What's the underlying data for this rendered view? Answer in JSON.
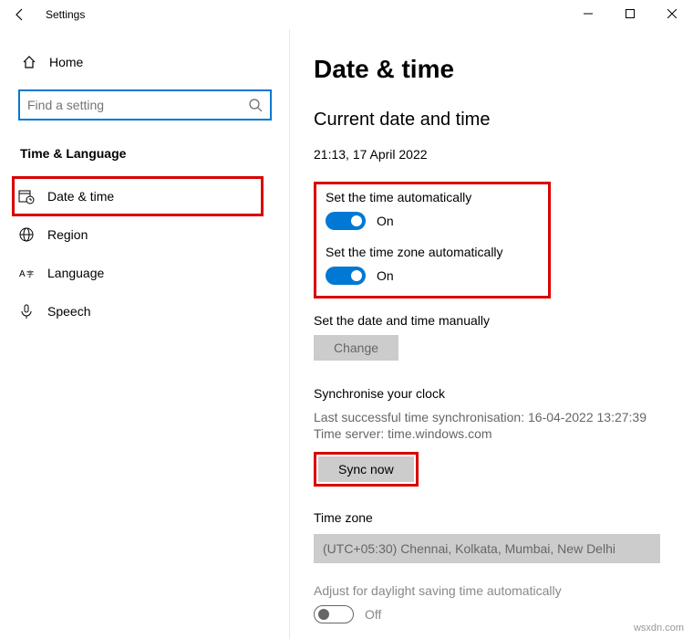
{
  "window": {
    "title": "Settings"
  },
  "sidebar": {
    "home_label": "Home",
    "search_placeholder": "Find a setting",
    "category": "Time & Language",
    "items": [
      {
        "label": "Date & time",
        "selected": true
      },
      {
        "label": "Region",
        "selected": false
      },
      {
        "label": "Language",
        "selected": false
      },
      {
        "label": "Speech",
        "selected": false
      }
    ]
  },
  "main": {
    "page_title": "Date & time",
    "section_title": "Current date and time",
    "current_datetime": "21:13, 17 April 2022",
    "auto_time_label": "Set the time automatically",
    "auto_time_state": "On",
    "auto_tz_label": "Set the time zone automatically",
    "auto_tz_state": "On",
    "manual_label": "Set the date and time manually",
    "change_btn": "Change",
    "sync_title": "Synchronise your clock",
    "sync_last": "Last successful time synchronisation: 16-04-2022 13:27:39",
    "sync_server": "Time server: time.windows.com",
    "sync_btn": "Sync now",
    "tz_title": "Time zone",
    "tz_value": "(UTC+05:30) Chennai, Kolkata, Mumbai, New Delhi",
    "dst_label": "Adjust for daylight saving time automatically",
    "dst_state": "Off"
  },
  "watermark": "wsxdn.com"
}
